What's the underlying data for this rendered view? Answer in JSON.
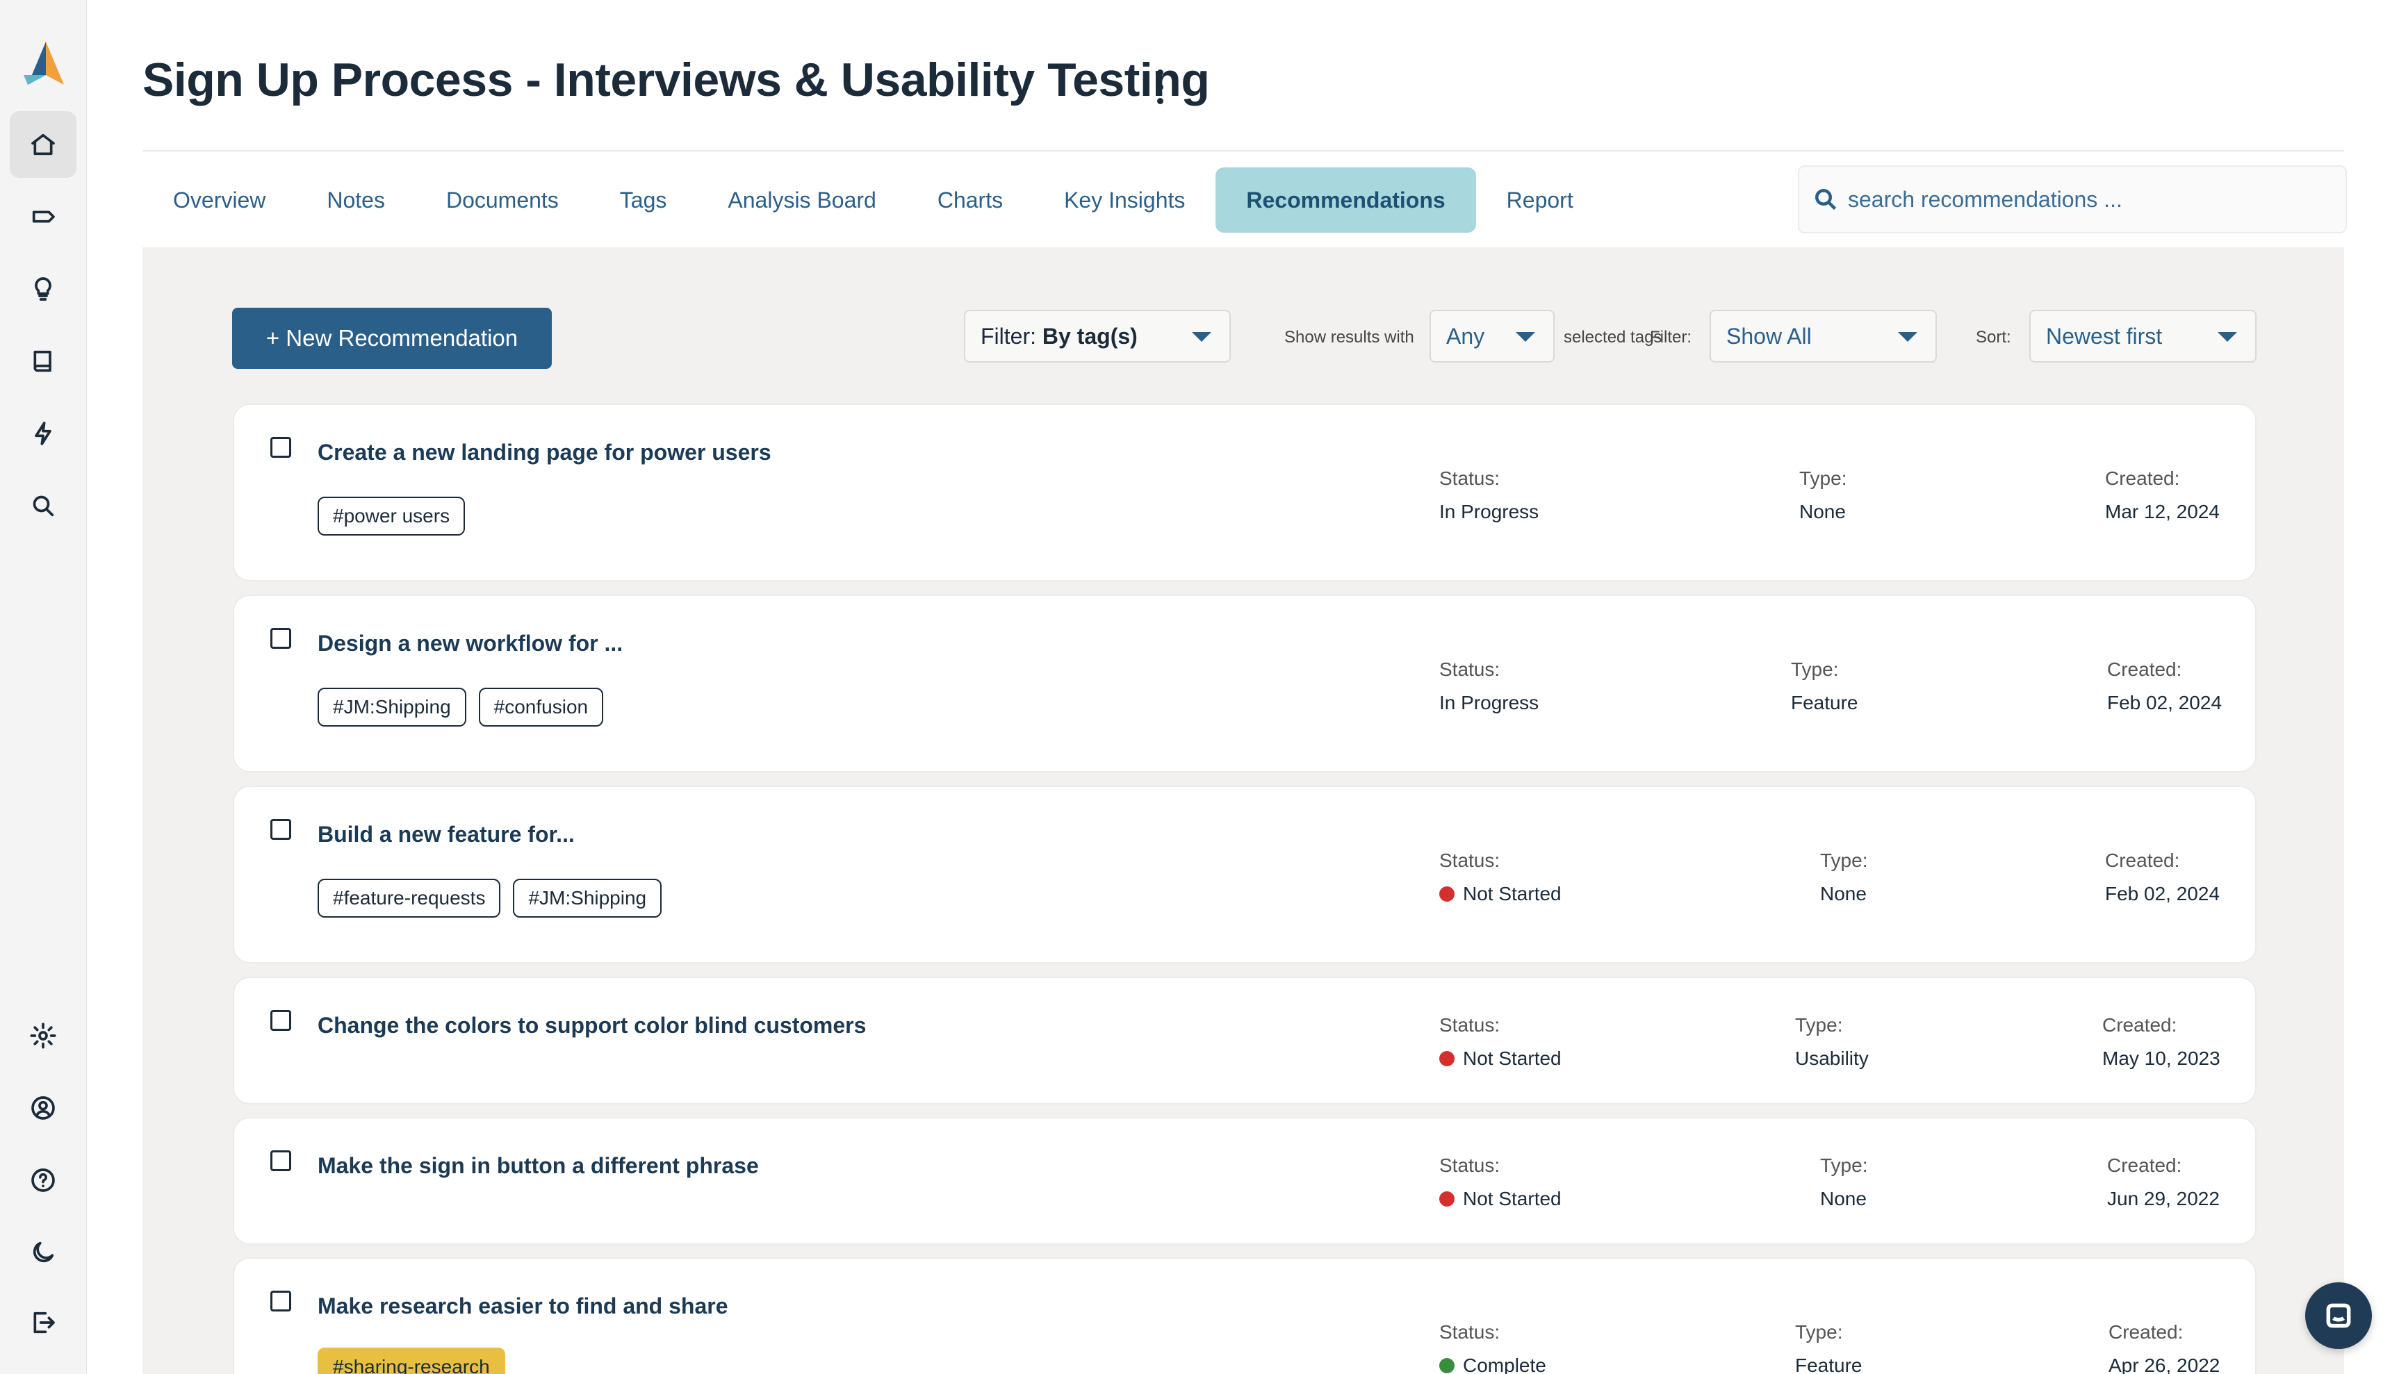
{
  "page": {
    "title": "Sign Up Process - Interviews & Usability Testing"
  },
  "sidebar": {
    "icons": [
      "home-icon",
      "tag-icon",
      "lightbulb-icon",
      "book-icon",
      "bolt-icon",
      "search-icon",
      "gear-icon",
      "user-circle-icon",
      "help-icon",
      "moon-icon",
      "logout-icon"
    ]
  },
  "tabs": [
    {
      "label": "Overview"
    },
    {
      "label": "Notes"
    },
    {
      "label": "Documents"
    },
    {
      "label": "Tags"
    },
    {
      "label": "Analysis Board"
    },
    {
      "label": "Charts"
    },
    {
      "label": "Key Insights"
    },
    {
      "label": "Recommendations",
      "active": true
    },
    {
      "label": "Report"
    }
  ],
  "search": {
    "placeholder": "search recommendations ..."
  },
  "toolbar": {
    "new_label": "+ New Recommendation",
    "filter_tag_prefix": "Filter: ",
    "filter_tag_value": "By tag(s)",
    "show_results_label": "Show results with",
    "any_value": "Any",
    "selected_tags_label": "selected tags",
    "filter_label": "Filter:",
    "filter_value": "Show All",
    "sort_label": "Sort:",
    "sort_value": "Newest first"
  },
  "labels": {
    "status": "Status:",
    "type": "Type:",
    "created": "Created:"
  },
  "colors": {
    "accent": "#2a5f8a",
    "active_tab": "#a8d8de",
    "not_started": "#d32f2f",
    "complete": "#388e3c",
    "tag_highlight": "#e8bf40"
  },
  "recommendations": [
    {
      "title": "Create a new landing page for power users",
      "tags": [
        "#power users"
      ],
      "status": "In Progress",
      "type": "None",
      "created": "Mar 12, 2024"
    },
    {
      "title": "Design a new workflow for ...",
      "tags": [
        "#JM:Shipping",
        "#confusion"
      ],
      "status": "In Progress",
      "type": "Feature",
      "created": "Feb 02, 2024"
    },
    {
      "title": "Build a new feature for...",
      "tags": [
        "#feature-requests",
        "#JM:Shipping"
      ],
      "status": "Not Started",
      "type": "None",
      "created": "Feb 02, 2024"
    },
    {
      "title": "Change the colors to support color blind customers",
      "tags": [],
      "status": "Not Started",
      "type": "Usability",
      "created": "May 10, 2023"
    },
    {
      "title": "Make the sign in button a different phrase",
      "tags": [],
      "status": "Not Started",
      "type": "None",
      "created": "Jun 29, 2022"
    },
    {
      "title": "Make research easier to find and share",
      "tags": [
        "#sharing-research"
      ],
      "status": "Complete",
      "type": "Feature",
      "created": "Apr 26, 2022"
    }
  ]
}
